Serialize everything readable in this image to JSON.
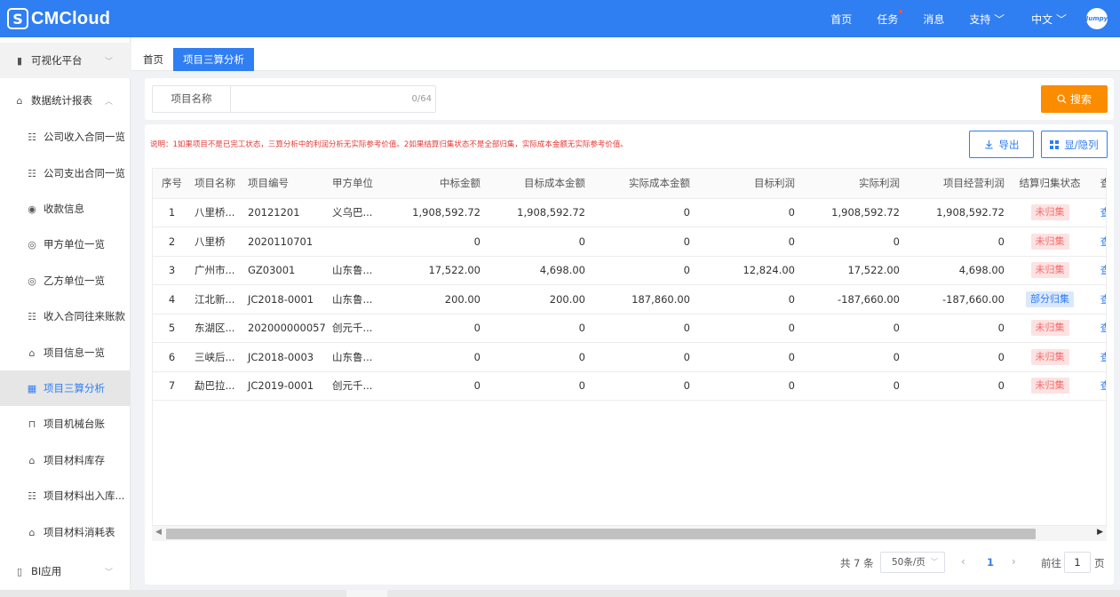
{
  "brand": {
    "logo_text": "CMCloud",
    "logo_mark": "S"
  },
  "topnav": {
    "items": [
      {
        "label": "首页"
      },
      {
        "label": "任务",
        "has_dot": true
      },
      {
        "label": "消息"
      },
      {
        "label": "支持 ﹀"
      },
      {
        "label": "中文 ﹀"
      }
    ],
    "avatar_text": "Jumpy"
  },
  "sidebar": {
    "items": [
      {
        "label": "可视化平台",
        "icon": "dashboard-icon",
        "glyph": "▮",
        "chevron": "﹀"
      },
      {
        "label": "数据统计报表",
        "icon": "report-icon",
        "glyph": "⌂",
        "chevron": "︿"
      },
      {
        "label": "公司收入合同一览",
        "icon": "contract-icon",
        "glyph": "☷"
      },
      {
        "label": "公司支出合同一览",
        "icon": "contract-icon",
        "glyph": "☷"
      },
      {
        "label": "收款信息",
        "icon": "money-icon",
        "glyph": "◉"
      },
      {
        "label": "甲方单位一览",
        "icon": "party-icon",
        "glyph": "◎"
      },
      {
        "label": "乙方单位一览",
        "icon": "party-icon",
        "glyph": "◎"
      },
      {
        "label": "收入合同往来账款",
        "icon": "ledger-icon",
        "glyph": "☷"
      },
      {
        "label": "项目信息一览",
        "icon": "home-icon",
        "glyph": "⌂"
      },
      {
        "label": "项目三算分析",
        "icon": "calendar-icon",
        "glyph": "▦",
        "active": true
      },
      {
        "label": "项目机械台账",
        "icon": "machine-icon",
        "glyph": "⊓"
      },
      {
        "label": "项目材料库存",
        "icon": "warehouse-icon",
        "glyph": "⌂"
      },
      {
        "label": "项目材料出入库...",
        "icon": "doc-icon",
        "glyph": "☷"
      },
      {
        "label": "项目材料消耗表",
        "icon": "home-icon",
        "glyph": "⌂"
      },
      {
        "label": "BI应用",
        "icon": "bi-icon",
        "glyph": "▯",
        "chevron": "﹀"
      }
    ]
  },
  "tabs": {
    "home": "首页",
    "active": "项目三算分析"
  },
  "filter": {
    "label": "项目名称",
    "value": "",
    "counter": "0/64",
    "search_label": "搜索",
    "search_icon": "search-icon"
  },
  "note": "说明：1如果项目不是已完工状态，三算分析中的利润分析无实际参考价值。2如果结算归集状态不是全部归集，实际成本金额无实际参考价值。",
  "actions": {
    "export_label": "导出",
    "export_icon": "download-icon",
    "columns_label": "显/隐列",
    "columns_icon": "grid-icon"
  },
  "table": {
    "columns": [
      "序号",
      "项目名称",
      "项目编号",
      "甲方单位",
      "中标金额",
      "目标成本金额",
      "实际成本金额",
      "目标利润",
      "实际利润",
      "项目经营利润",
      "结算归集状态",
      "查"
    ],
    "rows": [
      {
        "no": "1",
        "name": "八里桥...",
        "code": "20121201",
        "party": "义乌巴...",
        "bid": "1,908,592.72",
        "target_cost": "1,908,592.72",
        "actual_cost": "0",
        "target_profit": "0",
        "actual_profit": "1,908,592.72",
        "op_profit": "1,908,592.72",
        "status": "未归集",
        "status_type": "red",
        "op": "查"
      },
      {
        "no": "2",
        "name": "八里桥",
        "code": "2020110701",
        "party": "",
        "bid": "0",
        "target_cost": "0",
        "actual_cost": "0",
        "target_profit": "0",
        "actual_profit": "0",
        "op_profit": "0",
        "status": "未归集",
        "status_type": "red",
        "op": "查"
      },
      {
        "no": "3",
        "name": "广州市...",
        "code": "GZ03001",
        "party": "山东鲁...",
        "bid": "17,522.00",
        "target_cost": "4,698.00",
        "actual_cost": "0",
        "target_profit": "12,824.00",
        "actual_profit": "17,522.00",
        "op_profit": "4,698.00",
        "status": "未归集",
        "status_type": "red",
        "op": "查"
      },
      {
        "no": "4",
        "name": "江北新...",
        "code": "JC2018-0001",
        "party": "山东鲁...",
        "bid": "200.00",
        "target_cost": "200.00",
        "actual_cost": "187,860.00",
        "target_profit": "0",
        "actual_profit": "-187,660.00",
        "op_profit": "-187,660.00",
        "status": "部分归集",
        "status_type": "blue",
        "op": "查"
      },
      {
        "no": "5",
        "name": "东湖区...",
        "code": "202000000057",
        "party": "创元千...",
        "bid": "0",
        "target_cost": "0",
        "actual_cost": "0",
        "target_profit": "0",
        "actual_profit": "0",
        "op_profit": "0",
        "status": "未归集",
        "status_type": "red",
        "op": "查"
      },
      {
        "no": "6",
        "name": "三峡后...",
        "code": "JC2018-0003",
        "party": "山东鲁...",
        "bid": "0",
        "target_cost": "0",
        "actual_cost": "0",
        "target_profit": "0",
        "actual_profit": "0",
        "op_profit": "0",
        "status": "未归集",
        "status_type": "red",
        "op": "查"
      },
      {
        "no": "7",
        "name": "勐巴拉...",
        "code": "JC2019-0001",
        "party": "创元千...",
        "bid": "0",
        "target_cost": "0",
        "actual_cost": "0",
        "target_profit": "0",
        "actual_profit": "0",
        "op_profit": "0",
        "status": "未归集",
        "status_type": "red",
        "op": "查"
      }
    ]
  },
  "pagination": {
    "total": "共 7 条",
    "page_size": "50条/页",
    "current": "1",
    "goto_label": "前往",
    "goto_value": "1",
    "page_unit": "页"
  },
  "colors": {
    "primary": "#2f7ef2",
    "search": "#fb8c00",
    "danger": "#f56c6c"
  }
}
